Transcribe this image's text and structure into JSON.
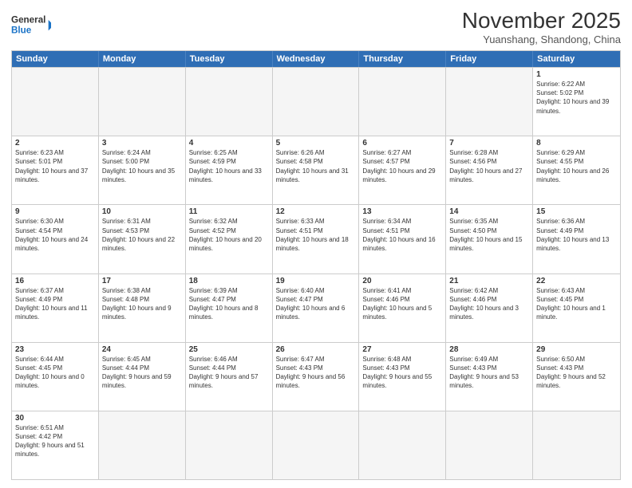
{
  "logo": {
    "line1": "General",
    "line2": "Blue"
  },
  "title": "November 2025",
  "subtitle": "Yuanshang, Shandong, China",
  "days_of_week": [
    "Sunday",
    "Monday",
    "Tuesday",
    "Wednesday",
    "Thursday",
    "Friday",
    "Saturday"
  ],
  "weeks": [
    [
      {
        "day": "",
        "info": ""
      },
      {
        "day": "",
        "info": ""
      },
      {
        "day": "",
        "info": ""
      },
      {
        "day": "",
        "info": ""
      },
      {
        "day": "",
        "info": ""
      },
      {
        "day": "",
        "info": ""
      },
      {
        "day": "1",
        "info": "Sunrise: 6:22 AM\nSunset: 5:02 PM\nDaylight: 10 hours and 39 minutes."
      }
    ],
    [
      {
        "day": "2",
        "info": "Sunrise: 6:23 AM\nSunset: 5:01 PM\nDaylight: 10 hours and 37 minutes."
      },
      {
        "day": "3",
        "info": "Sunrise: 6:24 AM\nSunset: 5:00 PM\nDaylight: 10 hours and 35 minutes."
      },
      {
        "day": "4",
        "info": "Sunrise: 6:25 AM\nSunset: 4:59 PM\nDaylight: 10 hours and 33 minutes."
      },
      {
        "day": "5",
        "info": "Sunrise: 6:26 AM\nSunset: 4:58 PM\nDaylight: 10 hours and 31 minutes."
      },
      {
        "day": "6",
        "info": "Sunrise: 6:27 AM\nSunset: 4:57 PM\nDaylight: 10 hours and 29 minutes."
      },
      {
        "day": "7",
        "info": "Sunrise: 6:28 AM\nSunset: 4:56 PM\nDaylight: 10 hours and 27 minutes."
      },
      {
        "day": "8",
        "info": "Sunrise: 6:29 AM\nSunset: 4:55 PM\nDaylight: 10 hours and 26 minutes."
      }
    ],
    [
      {
        "day": "9",
        "info": "Sunrise: 6:30 AM\nSunset: 4:54 PM\nDaylight: 10 hours and 24 minutes."
      },
      {
        "day": "10",
        "info": "Sunrise: 6:31 AM\nSunset: 4:53 PM\nDaylight: 10 hours and 22 minutes."
      },
      {
        "day": "11",
        "info": "Sunrise: 6:32 AM\nSunset: 4:52 PM\nDaylight: 10 hours and 20 minutes."
      },
      {
        "day": "12",
        "info": "Sunrise: 6:33 AM\nSunset: 4:51 PM\nDaylight: 10 hours and 18 minutes."
      },
      {
        "day": "13",
        "info": "Sunrise: 6:34 AM\nSunset: 4:51 PM\nDaylight: 10 hours and 16 minutes."
      },
      {
        "day": "14",
        "info": "Sunrise: 6:35 AM\nSunset: 4:50 PM\nDaylight: 10 hours and 15 minutes."
      },
      {
        "day": "15",
        "info": "Sunrise: 6:36 AM\nSunset: 4:49 PM\nDaylight: 10 hours and 13 minutes."
      }
    ],
    [
      {
        "day": "16",
        "info": "Sunrise: 6:37 AM\nSunset: 4:49 PM\nDaylight: 10 hours and 11 minutes."
      },
      {
        "day": "17",
        "info": "Sunrise: 6:38 AM\nSunset: 4:48 PM\nDaylight: 10 hours and 9 minutes."
      },
      {
        "day": "18",
        "info": "Sunrise: 6:39 AM\nSunset: 4:47 PM\nDaylight: 10 hours and 8 minutes."
      },
      {
        "day": "19",
        "info": "Sunrise: 6:40 AM\nSunset: 4:47 PM\nDaylight: 10 hours and 6 minutes."
      },
      {
        "day": "20",
        "info": "Sunrise: 6:41 AM\nSunset: 4:46 PM\nDaylight: 10 hours and 5 minutes."
      },
      {
        "day": "21",
        "info": "Sunrise: 6:42 AM\nSunset: 4:46 PM\nDaylight: 10 hours and 3 minutes."
      },
      {
        "day": "22",
        "info": "Sunrise: 6:43 AM\nSunset: 4:45 PM\nDaylight: 10 hours and 1 minute."
      }
    ],
    [
      {
        "day": "23",
        "info": "Sunrise: 6:44 AM\nSunset: 4:45 PM\nDaylight: 10 hours and 0 minutes."
      },
      {
        "day": "24",
        "info": "Sunrise: 6:45 AM\nSunset: 4:44 PM\nDaylight: 9 hours and 59 minutes."
      },
      {
        "day": "25",
        "info": "Sunrise: 6:46 AM\nSunset: 4:44 PM\nDaylight: 9 hours and 57 minutes."
      },
      {
        "day": "26",
        "info": "Sunrise: 6:47 AM\nSunset: 4:43 PM\nDaylight: 9 hours and 56 minutes."
      },
      {
        "day": "27",
        "info": "Sunrise: 6:48 AM\nSunset: 4:43 PM\nDaylight: 9 hours and 55 minutes."
      },
      {
        "day": "28",
        "info": "Sunrise: 6:49 AM\nSunset: 4:43 PM\nDaylight: 9 hours and 53 minutes."
      },
      {
        "day": "29",
        "info": "Sunrise: 6:50 AM\nSunset: 4:43 PM\nDaylight: 9 hours and 52 minutes."
      }
    ],
    [
      {
        "day": "30",
        "info": "Sunrise: 6:51 AM\nSunset: 4:42 PM\nDaylight: 9 hours and 51 minutes."
      },
      {
        "day": "",
        "info": ""
      },
      {
        "day": "",
        "info": ""
      },
      {
        "day": "",
        "info": ""
      },
      {
        "day": "",
        "info": ""
      },
      {
        "day": "",
        "info": ""
      },
      {
        "day": "",
        "info": ""
      }
    ]
  ]
}
